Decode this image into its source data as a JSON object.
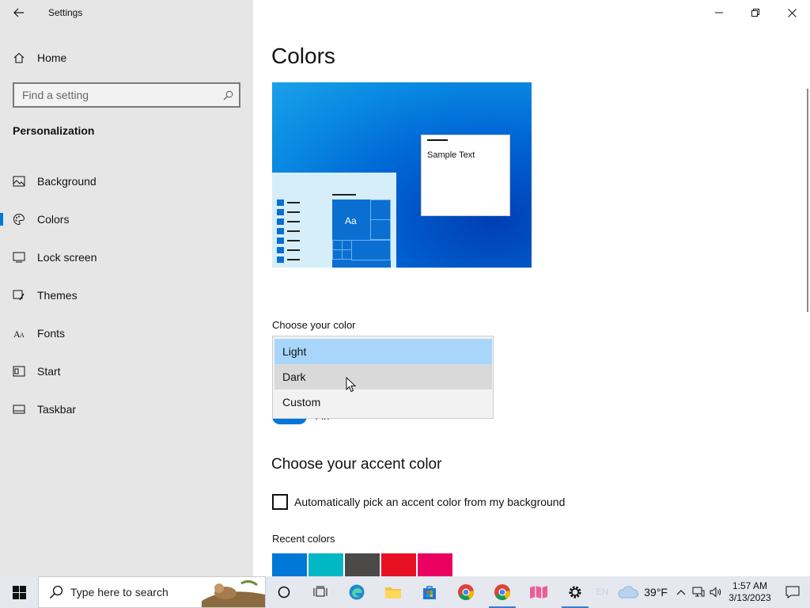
{
  "app": {
    "title": "Settings"
  },
  "sidebar": {
    "home_label": "Home",
    "search_placeholder": "Find a setting",
    "section_title": "Personalization",
    "items": [
      {
        "label": "Background",
        "icon": "picture-icon"
      },
      {
        "label": "Colors",
        "icon": "palette-icon",
        "active": true
      },
      {
        "label": "Lock screen",
        "icon": "lock-screen-icon"
      },
      {
        "label": "Themes",
        "icon": "brush-icon"
      },
      {
        "label": "Fonts",
        "icon": "font-icon"
      },
      {
        "label": "Start",
        "icon": "start-icon"
      },
      {
        "label": "Taskbar",
        "icon": "taskbar-icon"
      }
    ]
  },
  "main": {
    "title": "Colors",
    "preview": {
      "tile_text": "Aa",
      "sample_text": "Sample Text"
    },
    "choose_color_label": "Choose your color",
    "color_options": [
      "Light",
      "Dark",
      "Custom"
    ],
    "selected_option": "Light",
    "hovered_option": "Dark",
    "toggle_text": "On",
    "accent_title": "Choose your accent color",
    "auto_pick_label": "Automatically pick an accent color from my background",
    "auto_pick_checked": false,
    "recent_colors_label": "Recent colors",
    "recent_colors": [
      "#0078d7",
      "#00b7c3",
      "#4c4a48",
      "#e81123",
      "#ea005e"
    ]
  },
  "taskbar": {
    "search_placeholder": "Type here to search",
    "apps": [
      "cortana-icon",
      "task-view-icon",
      "edge-icon",
      "file-explorer-icon",
      "store-icon",
      "chrome-icon",
      "chrome-icon-2",
      "maps-icon",
      "settings-icon"
    ],
    "language": "EN",
    "weather": "39°F",
    "time": "1:57 AM",
    "date": "3/13/2023"
  },
  "colors": {
    "accent": "#0078d7",
    "sidebar_bg": "#e6e6e6",
    "dropdown_selected": "#a8d6fb"
  }
}
